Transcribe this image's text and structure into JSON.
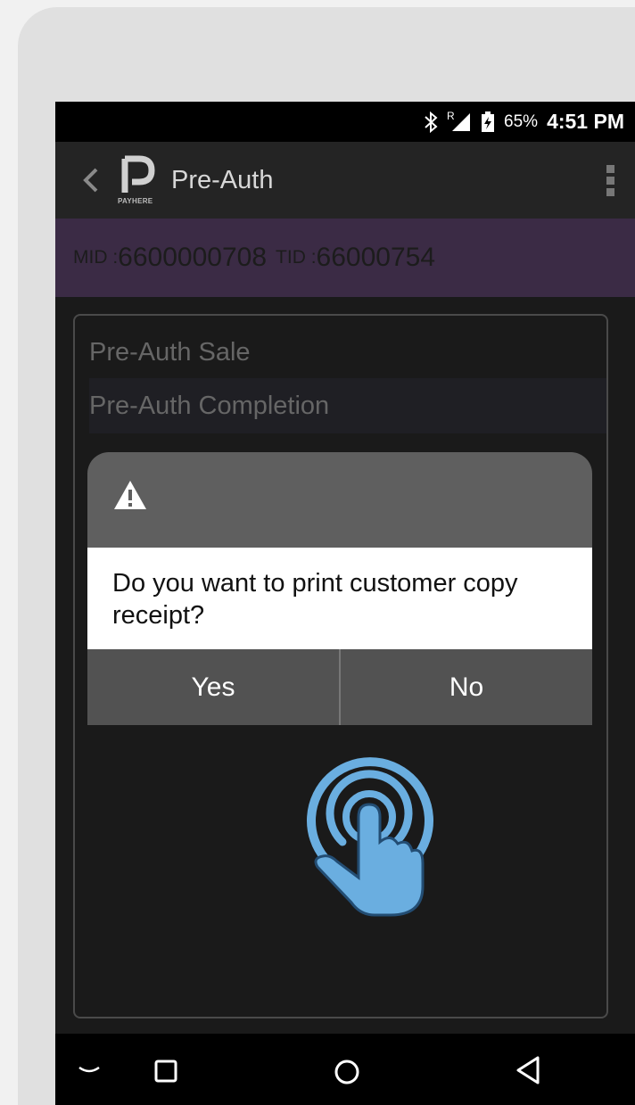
{
  "status_bar": {
    "network_label": "R",
    "battery_percent": "65%",
    "time": "4:51 PM"
  },
  "app_bar": {
    "logo_sub": "PAYHERE",
    "title": "Pre-Auth"
  },
  "merchant": {
    "mid_label": "MID : ",
    "mid_value": "6600000708",
    "tid_label": "TID : ",
    "tid_value": "66000754"
  },
  "menu": {
    "items": [
      {
        "label": "Pre-Auth Sale"
      },
      {
        "label": "Pre-Auth Completion"
      }
    ]
  },
  "dialog": {
    "message": "Do you want to print customer copy receipt?",
    "yes_label": "Yes",
    "no_label": "No"
  },
  "colors": {
    "mid_bar": "#3b2b45",
    "gesture": "#6aaee0"
  }
}
